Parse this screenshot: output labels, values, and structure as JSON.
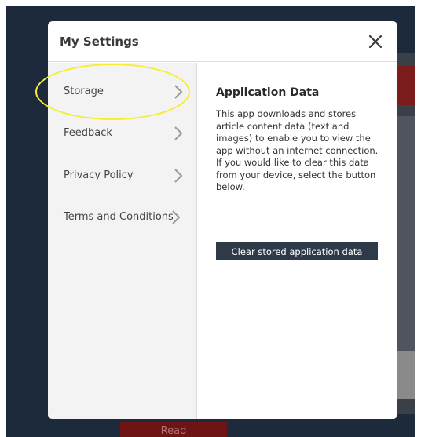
{
  "modal": {
    "title": "My Settings",
    "close_icon": "close-icon"
  },
  "sidebar": {
    "items": [
      {
        "label": "Storage",
        "icon": "chevron-right-icon",
        "selected": true
      },
      {
        "label": "Feedback",
        "icon": "chevron-right-icon",
        "selected": false
      },
      {
        "label": "Privacy Policy",
        "icon": "chevron-right-icon",
        "selected": false
      },
      {
        "label": "Terms and Conditions",
        "icon": "chevron-right-icon",
        "selected": false
      }
    ]
  },
  "content": {
    "title": "Application Data",
    "body": "This app downloads and stores article content data (text and images) to enable you to view the app without an internet connection. If you would like to clear this data from your device, select the button below.",
    "button_label": "Clear stored application data"
  },
  "background": {
    "read_button_label": "Read"
  },
  "colors": {
    "backdrop": "#1d2a3c",
    "button": "#2e3a48",
    "highlight": "#f5ee35",
    "read_button": "#6e1414"
  }
}
